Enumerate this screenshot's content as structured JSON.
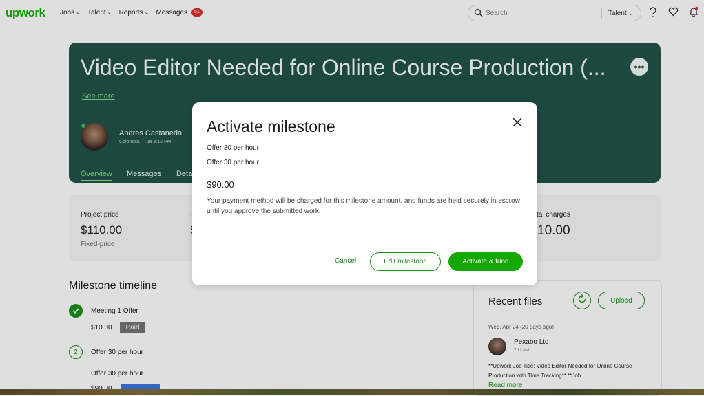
{
  "topbar": {
    "logo": "upwork",
    "nav": [
      {
        "label": "Jobs"
      },
      {
        "label": "Talent"
      },
      {
        "label": "Reports"
      },
      {
        "label": "Messages",
        "badge": "51"
      }
    ],
    "search": {
      "placeholder": "Search",
      "scope": "Talent"
    },
    "icons": [
      "help-icon",
      "heart-icon",
      "bell-icon"
    ]
  },
  "contract": {
    "title": "Video Editor Needed for Online Course Production (...",
    "see_more": "See more",
    "more_symbol": "•••",
    "freelancer": {
      "name": "Andres Castaneda",
      "meta": "Colombia · Tue 3:12 PM"
    },
    "tabs": [
      "Overview",
      "Messages",
      "Deta"
    ],
    "summary": {
      "project_price_label": "Project price",
      "project_price_value": "$110.00",
      "project_price_sub": "Fixed-price",
      "partial_label": "I",
      "partial_value": "$",
      "total_label": "tal charges",
      "total_value": "10.00"
    }
  },
  "milestones": {
    "title": "Milestone timeline",
    "items": [
      {
        "name": "Meeting 1 Offer",
        "amount": "$10.00",
        "status": "Paid"
      },
      {
        "index": "2",
        "name": "Offer 30 per hour",
        "detail": "Offer 30 per hour",
        "amount": "$90.00"
      }
    ]
  },
  "files": {
    "title": "Recent files",
    "upload_label": "Upload",
    "date": "Wed, Apr 24  (20 days ago)",
    "sender": "Pexabo Ltd",
    "time": "7:12 AM",
    "description": "**Upwork Job Title: Video Editor Needed for Online Course Production with Time Tracking** **Job...",
    "read_more": "Read more"
  },
  "modal": {
    "title": "Activate milestone",
    "line1": "Offer 30 per hour",
    "line2": "Offer 30 per hour",
    "amount": "$90.00",
    "description": "Your payment method will be charged for this milestone amount, and funds are held securely in escrow until you approve the submitted work.",
    "cancel": "Cancel",
    "edit": "Edit milestone",
    "activate": "Activate & fund"
  },
  "colors": {
    "brand": "#14a800",
    "hero": "#1f4f45",
    "badge": "#c9302c"
  }
}
